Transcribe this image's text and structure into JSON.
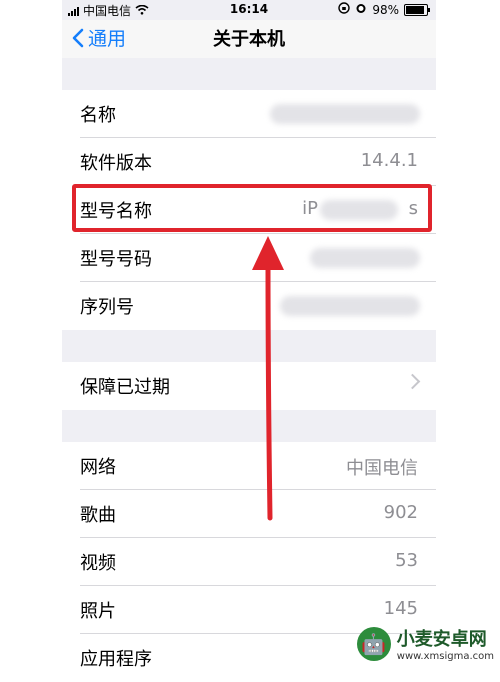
{
  "status_bar": {
    "carrier": "中国电信",
    "time": "16:14",
    "battery": "98%",
    "battery_level": 0.98
  },
  "nav": {
    "back_label": "通用",
    "title": "关于本机"
  },
  "rows": [
    {
      "label": "名称",
      "value": ""
    },
    {
      "label": "软件版本",
      "value": "14.4.1"
    },
    {
      "label": "型号名称",
      "value": "iP",
      "value_tail": "s"
    },
    {
      "label": "型号号码",
      "value": ""
    },
    {
      "label": "序列号",
      "value": ""
    }
  ],
  "warranty": {
    "label": "保障已过期"
  },
  "stats": [
    {
      "label": "网络",
      "value": "中国电信"
    },
    {
      "label": "歌曲",
      "value": "902"
    },
    {
      "label": "视频",
      "value": "53"
    },
    {
      "label": "照片",
      "value": "145"
    },
    {
      "label": "应用程序",
      "value": ""
    }
  ],
  "watermark": {
    "name": "小麦安卓网",
    "url": "www.xmsigma.com"
  },
  "colors": {
    "accent": "#147efb",
    "highlight": "#e0242c"
  }
}
